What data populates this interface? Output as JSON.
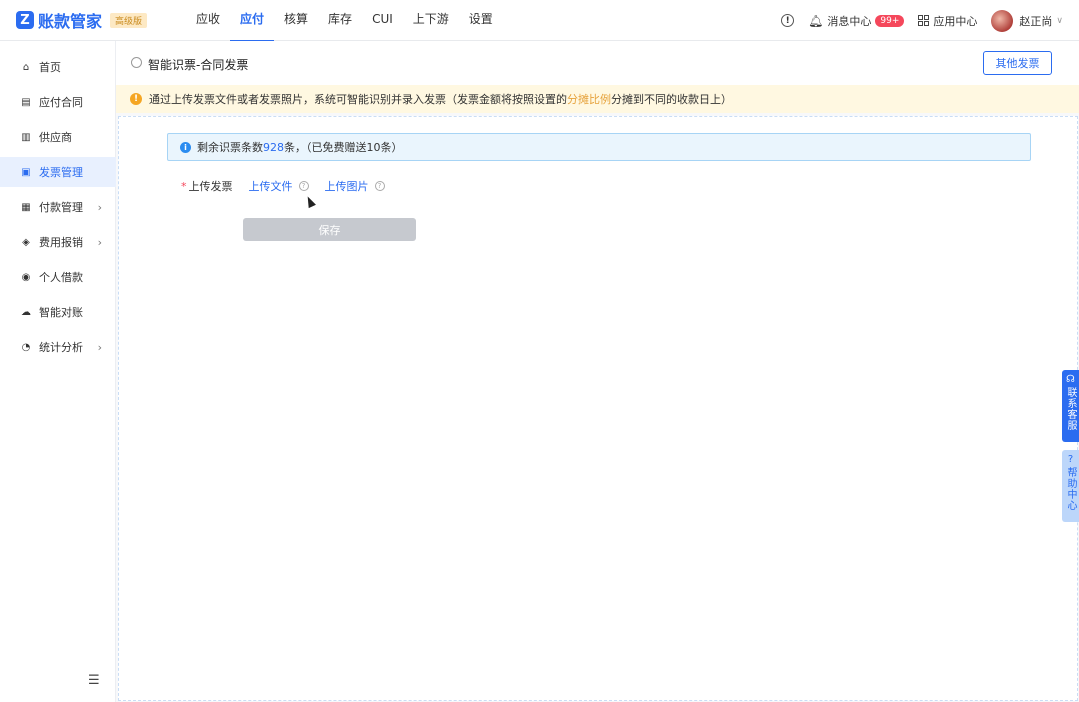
{
  "header": {
    "logo_mark": "Z",
    "logo_text": "账款管家",
    "edition": "高级版",
    "nav": [
      {
        "label": "应收",
        "active": false
      },
      {
        "label": "应付",
        "active": true
      },
      {
        "label": "核算",
        "active": false
      },
      {
        "label": "库存",
        "active": false
      },
      {
        "label": "CUI",
        "active": false
      },
      {
        "label": "上下游",
        "active": false
      },
      {
        "label": "设置",
        "active": false
      }
    ],
    "messages_label": "消息中心",
    "messages_count": "99+",
    "apps_label": "应用中心",
    "user_name": "赵正尚"
  },
  "sidebar": {
    "items": [
      {
        "label": "首页",
        "icon": "home-icon",
        "glyph": "⌂",
        "arrow": false,
        "active": false
      },
      {
        "label": "应付合同",
        "icon": "contract-icon",
        "glyph": "▤",
        "arrow": false,
        "active": false
      },
      {
        "label": "供应商",
        "icon": "supplier-icon",
        "glyph": "▥",
        "arrow": false,
        "active": false
      },
      {
        "label": "发票管理",
        "icon": "invoice-icon",
        "glyph": "▣",
        "arrow": false,
        "active": true
      },
      {
        "label": "付款管理",
        "icon": "payment-icon",
        "glyph": "▦",
        "arrow": true,
        "active": false
      },
      {
        "label": "费用报销",
        "icon": "expense-icon",
        "glyph": "◈",
        "arrow": true,
        "active": false
      },
      {
        "label": "个人借款",
        "icon": "loan-icon",
        "glyph": "◉",
        "arrow": false,
        "active": false
      },
      {
        "label": "智能对账",
        "icon": "reconcile-icon",
        "glyph": "☁",
        "arrow": false,
        "active": false
      },
      {
        "label": "统计分析",
        "icon": "stats-icon",
        "glyph": "◔",
        "arrow": true,
        "active": false
      }
    ]
  },
  "page": {
    "title": "智能识票-合同发票",
    "other_invoice_button": "其他发票",
    "notice_prefix": "通过上传发票文件或者发票照片，系统可智能识别并录入发票（发票金额将按照设置的",
    "notice_highlight": "分摊比例",
    "notice_suffix": "分摊到不同的收款日上）",
    "quota_prefix": "剩余识票条数 ",
    "quota_count": "928",
    "quota_suffix": "条，（已免费赠送10条）",
    "upload_label": "上传发票",
    "upload_file": "上传文件",
    "upload_image": "上传图片",
    "save_button": "保存"
  },
  "floating": {
    "customer_service": "联系客服",
    "help_center": "帮助中心"
  },
  "colors": {
    "accent": "#2b6cf0",
    "badge": "#f5475b",
    "notice_bg": "#fff8e1",
    "disabled_btn": "#c6c9cf"
  }
}
